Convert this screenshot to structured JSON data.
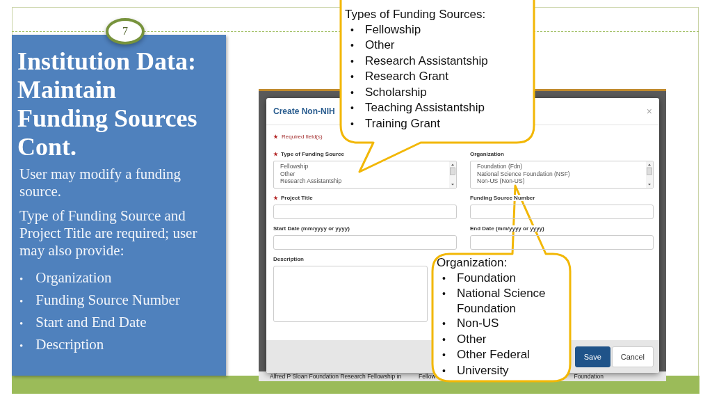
{
  "slide": {
    "number": "7",
    "title_lines": [
      "Institution Data:",
      "Maintain",
      "Funding Sources",
      "Cont."
    ],
    "paragraphs": [
      "User may modify a funding source.",
      "Type of Funding Source and Project Title are required; user may also provide:"
    ],
    "bullet_mark": "•",
    "bullets": [
      "Organization",
      "Funding Source Number",
      "Start and End Date",
      "Description"
    ]
  },
  "screenshot": {
    "background_row": [
      "Alfred P Sloan Foundation Research Fellowship in",
      "Fellow",
      "Foundation"
    ],
    "modal": {
      "title": "Create Non-NIH",
      "close": "×",
      "required_note": "Required field(s)",
      "fields": [
        {
          "label": "Type of Funding Source",
          "required": true,
          "kind": "listbox",
          "options": [
            "Fellowship",
            "Other",
            "Research Assistantship"
          ]
        },
        {
          "label": "Organization",
          "required": false,
          "kind": "listbox",
          "options": [
            "Foundation (Fdn)",
            "National Science Foundation (NSF)",
            "Non-US (Non-US)"
          ]
        },
        {
          "label": "Project Title",
          "required": true,
          "kind": "text"
        },
        {
          "label": "Funding Source Number",
          "required": false,
          "kind": "text"
        },
        {
          "label": "Start Date (mm/yyyy or yyyy)",
          "required": false,
          "kind": "text"
        },
        {
          "label": "End Date (mm/yyyy or yyyy)",
          "required": false,
          "kind": "text"
        },
        {
          "label": "Description",
          "required": false,
          "kind": "textarea"
        }
      ],
      "buttons": [
        {
          "label": "Save",
          "kind": "primary"
        },
        {
          "label": "Cancel",
          "kind": "default"
        }
      ]
    }
  },
  "callouts": [
    {
      "heading": "Types of Funding Sources:",
      "bullet": "•",
      "items": [
        "Fellowship",
        "Other",
        "Research Assistantship",
        "Research Grant",
        "Scholarship",
        "Teaching Assistantship",
        "Training Grant"
      ]
    },
    {
      "heading": "Organization:",
      "bullet": "•",
      "items": [
        "Foundation",
        "National Science Foundation",
        "Non-US",
        "Other",
        "Other Federal",
        "University"
      ]
    }
  ]
}
